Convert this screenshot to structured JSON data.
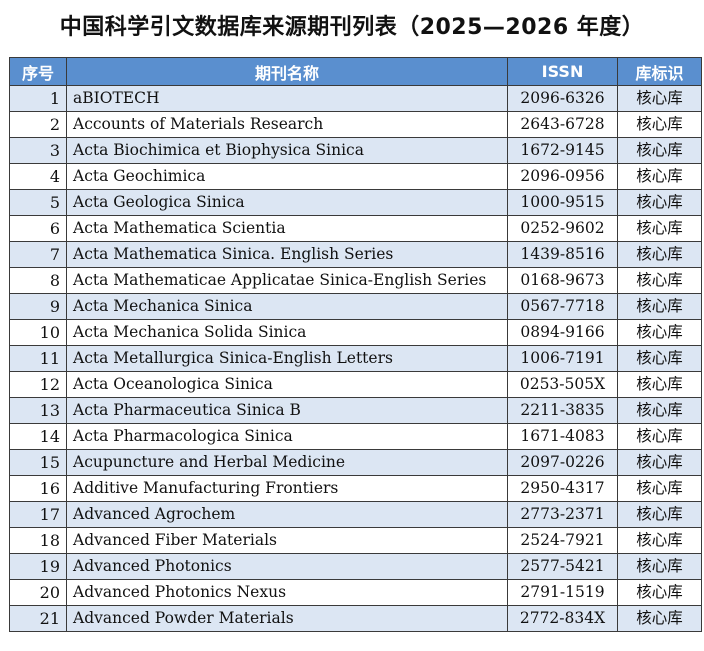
{
  "title": "中国科学引文数据库来源期刊列表（2025—2026 年度）",
  "table": {
    "headers": {
      "no": "序号",
      "name": "期刊名称",
      "issn": "ISSN",
      "tag": "库标识"
    },
    "rows": [
      {
        "no": "1",
        "name": "aBIOTECH",
        "issn": "2096-6326",
        "tag": "核心库"
      },
      {
        "no": "2",
        "name": "Accounts of Materials Research",
        "issn": "2643-6728",
        "tag": "核心库"
      },
      {
        "no": "3",
        "name": "Acta Biochimica et Biophysica Sinica",
        "issn": "1672-9145",
        "tag": "核心库"
      },
      {
        "no": "4",
        "name": "Acta Geochimica",
        "issn": "2096-0956",
        "tag": "核心库"
      },
      {
        "no": "5",
        "name": "Acta Geologica Sinica",
        "issn": "1000-9515",
        "tag": "核心库"
      },
      {
        "no": "6",
        "name": "Acta Mathematica Scientia",
        "issn": "0252-9602",
        "tag": "核心库"
      },
      {
        "no": "7",
        "name": "Acta Mathematica Sinica. English Series",
        "issn": "1439-8516",
        "tag": "核心库"
      },
      {
        "no": "8",
        "name": "Acta Mathematicae Applicatae Sinica-English Series",
        "issn": "0168-9673",
        "tag": "核心库"
      },
      {
        "no": "9",
        "name": "Acta Mechanica Sinica",
        "issn": "0567-7718",
        "tag": "核心库"
      },
      {
        "no": "10",
        "name": "Acta Mechanica Solida Sinica",
        "issn": "0894-9166",
        "tag": "核心库"
      },
      {
        "no": "11",
        "name": "Acta Metallurgica Sinica-English Letters",
        "issn": "1006-7191",
        "tag": "核心库"
      },
      {
        "no": "12",
        "name": "Acta Oceanologica Sinica",
        "issn": "0253-505X",
        "tag": "核心库"
      },
      {
        "no": "13",
        "name": "Acta Pharmaceutica Sinica B",
        "issn": "2211-3835",
        "tag": "核心库"
      },
      {
        "no": "14",
        "name": "Acta Pharmacologica Sinica",
        "issn": "1671-4083",
        "tag": "核心库"
      },
      {
        "no": "15",
        "name": "Acupuncture and Herbal Medicine",
        "issn": "2097-0226",
        "tag": "核心库"
      },
      {
        "no": "16",
        "name": "Additive Manufacturing Frontiers",
        "issn": "2950-4317",
        "tag": "核心库"
      },
      {
        "no": "17",
        "name": "Advanced Agrochem",
        "issn": "2773-2371",
        "tag": "核心库"
      },
      {
        "no": "18",
        "name": "Advanced Fiber Materials",
        "issn": "2524-7921",
        "tag": "核心库"
      },
      {
        "no": "19",
        "name": "Advanced Photonics",
        "issn": "2577-5421",
        "tag": "核心库"
      },
      {
        "no": "20",
        "name": "Advanced Photonics Nexus",
        "issn": "2791-1519",
        "tag": "核心库"
      },
      {
        "no": "21",
        "name": "Advanced Powder Materials",
        "issn": "2772-834X",
        "tag": "核心库"
      }
    ]
  },
  "colors": {
    "header_bg": "#5a8fcf",
    "stripe_bg": "#dce6f3",
    "row_bg": "#ffffff"
  }
}
